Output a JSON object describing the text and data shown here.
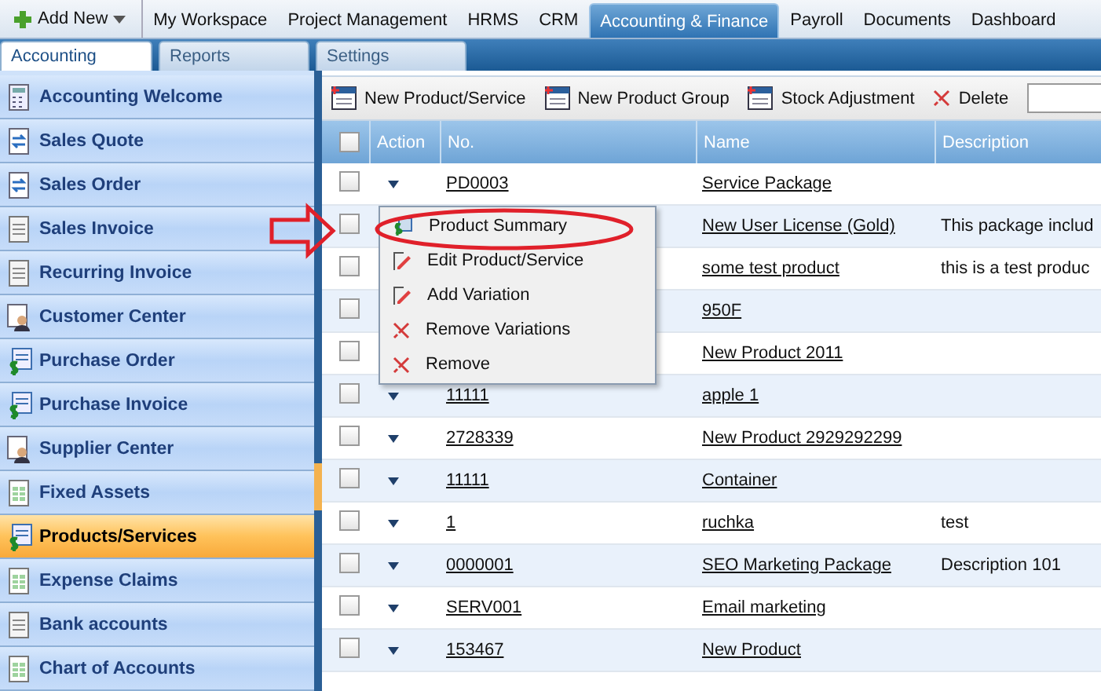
{
  "top_nav": {
    "add_new": "Add New",
    "tabs": [
      {
        "label": "My Workspace",
        "selected": false
      },
      {
        "label": "Project Management",
        "selected": false
      },
      {
        "label": "HRMS",
        "selected": false
      },
      {
        "label": "CRM",
        "selected": false
      },
      {
        "label": "Accounting & Finance",
        "selected": true
      },
      {
        "label": "Payroll",
        "selected": false
      },
      {
        "label": "Documents",
        "selected": false
      },
      {
        "label": "Dashboard",
        "selected": false
      }
    ]
  },
  "sub_tabs": [
    {
      "label": "Accounting",
      "selected": true
    },
    {
      "label": "Reports",
      "selected": false
    },
    {
      "label": "Settings",
      "selected": false
    }
  ],
  "sidebar": {
    "items": [
      {
        "label": "Accounting Welcome",
        "kind": "calculator",
        "selected": false
      },
      {
        "label": "Sales Quote",
        "kind": "transfer",
        "selected": false
      },
      {
        "label": "Sales Order",
        "kind": "transfer",
        "selected": false
      },
      {
        "label": "Sales Invoice",
        "kind": "document",
        "selected": false
      },
      {
        "label": "Recurring Invoice",
        "kind": "document",
        "selected": false
      },
      {
        "label": "Customer Center",
        "kind": "person",
        "selected": false
      },
      {
        "label": "Purchase Order",
        "kind": "money",
        "selected": false
      },
      {
        "label": "Purchase Invoice",
        "kind": "money",
        "selected": false
      },
      {
        "label": "Supplier Center",
        "kind": "person",
        "selected": false
      },
      {
        "label": "Fixed Assets",
        "kind": "sheet",
        "selected": false
      },
      {
        "label": "Products/Services",
        "kind": "money",
        "selected": true
      },
      {
        "label": "Expense Claims",
        "kind": "sheet",
        "selected": false
      },
      {
        "label": "Bank accounts",
        "kind": "document",
        "selected": false
      },
      {
        "label": "Chart of Accounts",
        "kind": "sheet",
        "selected": false
      }
    ]
  },
  "toolbar": {
    "buttons": [
      {
        "label": "New Product/Service",
        "kind": "new"
      },
      {
        "label": "New Product Group",
        "kind": "new"
      },
      {
        "label": "Stock Adjustment",
        "kind": "new"
      },
      {
        "label": "Delete",
        "kind": "delete"
      }
    ]
  },
  "table": {
    "all_checked": false,
    "columns": [
      "Action",
      "No.",
      "Name",
      "Description"
    ],
    "rows": [
      {
        "number": "PD0003",
        "name": "Service Package",
        "checked": false
      },
      {
        "name": "New User License (Gold)",
        "description": "This package includ",
        "checked": false
      },
      {
        "name": "some test product",
        "description": "this is a test produc",
        "checked": false
      },
      {
        "name": "950F",
        "checked": false
      },
      {
        "name": "New Product 2011",
        "checked": false
      },
      {
        "number": "11111",
        "name": "apple 1",
        "checked": false
      },
      {
        "number": "2728339",
        "name": "New Product 2929292299",
        "checked": false
      },
      {
        "number": "11111",
        "name": "Container",
        "checked": false
      },
      {
        "number": "1",
        "name": "ruchka",
        "description": "test",
        "checked": false
      },
      {
        "number": "0000001",
        "name": "SEO Marketing Package",
        "description": "Description 101",
        "checked": false
      },
      {
        "number": "SERV001",
        "name": "Email marketing",
        "checked": false
      },
      {
        "number": "153467",
        "name": "New Product",
        "checked": false
      }
    ]
  },
  "context_menu": {
    "items": [
      {
        "label": "Product Summary",
        "kind": "summary"
      },
      {
        "label": "Edit Product/Service",
        "kind": "edit"
      },
      {
        "label": "Add Variation",
        "kind": "edit"
      },
      {
        "label": "Remove Variations",
        "kind": "remove"
      },
      {
        "label": "Remove",
        "kind": "remove"
      }
    ]
  }
}
